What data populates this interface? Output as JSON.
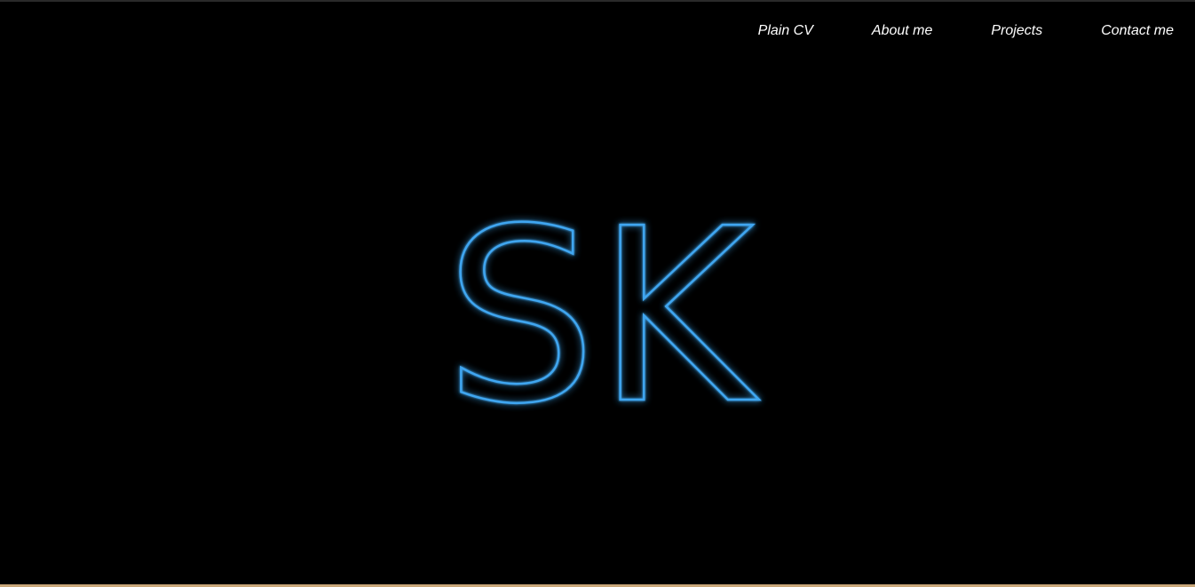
{
  "nav": {
    "items": [
      {
        "label": "Plain CV"
      },
      {
        "label": "About me"
      },
      {
        "label": "Projects"
      },
      {
        "label": "Contact me"
      }
    ]
  },
  "hero": {
    "logo_text": "SK",
    "accent_color": "#3fa6f0"
  }
}
